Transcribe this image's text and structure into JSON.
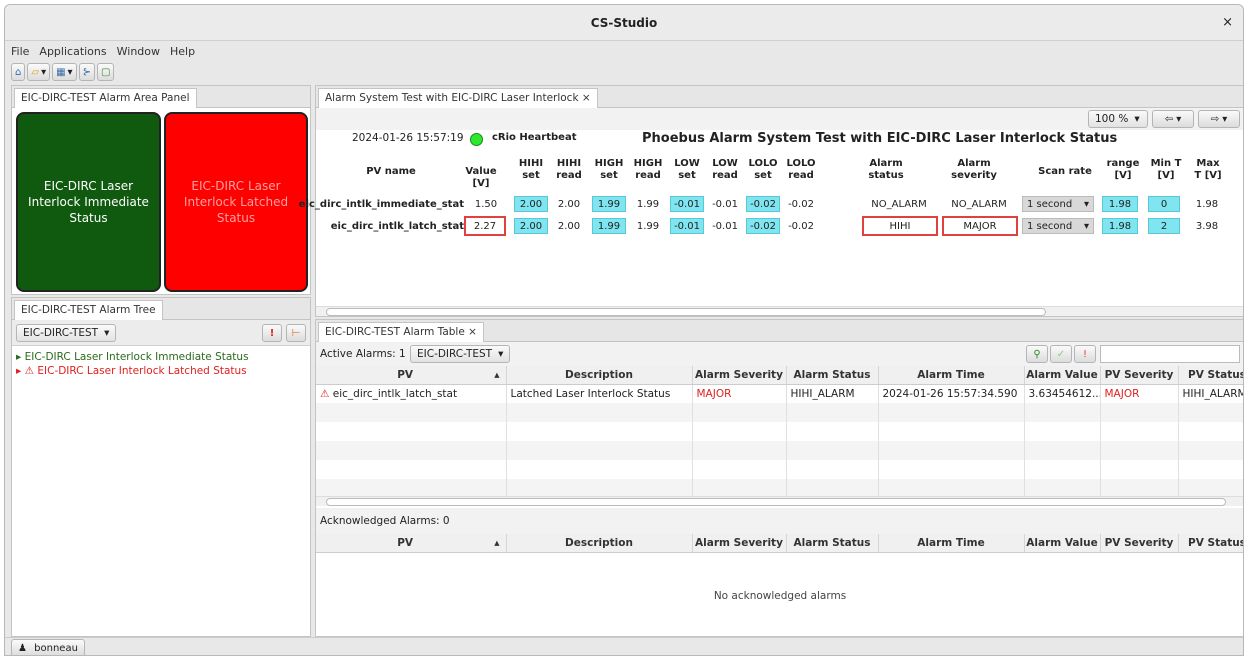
{
  "window": {
    "title": "CS-Studio",
    "close": "×"
  },
  "menu": [
    "File",
    "Applications",
    "Window",
    "Help"
  ],
  "area_panel": {
    "tab": "EIC-DIRC-TEST Alarm Area Panel",
    "tiles": [
      {
        "label": "EIC-DIRC Laser Interlock Immediate Status",
        "color": "#0f5a0f",
        "text_color": "#ffffff"
      },
      {
        "label": "EIC-DIRC Laser Interlock Latched Status",
        "color": "#ff0000",
        "text_color": "#ff9f9f"
      }
    ]
  },
  "alarm_tree": {
    "tab": "EIC-DIRC-TEST Alarm Tree",
    "config": "EIC-DIRC-TEST",
    "items": [
      {
        "label": "EIC-DIRC Laser Interlock Immediate Status",
        "status": "ok"
      },
      {
        "label": "EIC-DIRC Laser Interlock Latched Status",
        "status": "alarm"
      }
    ]
  },
  "display": {
    "tab": "Alarm System Test with EIC-DIRC Laser Interlock",
    "zoom": "100 %",
    "timestamp": "2024-01-26 15:57:19",
    "heartbeat": "cRio Heartbeat",
    "title": "Phoebus Alarm System Test with EIC-DIRC Laser Interlock Status",
    "headers": [
      "PV name",
      "Value [V]",
      "HIHI set",
      "HIHI read",
      "HIGH set",
      "HIGH read",
      "LOW set",
      "LOW read",
      "LOLO set",
      "LOLO read",
      "Alarm status",
      "Alarm severity",
      "Scan rate",
      "range [V]",
      "Min T [V]",
      "Max T [V]"
    ],
    "rows": [
      {
        "pv": "eic_dirc_intlk_immediate_stat",
        "value": "1.50",
        "hihi_set": "2.00",
        "hihi_read": "2.00",
        "high_set": "1.99",
        "high_read": "1.99",
        "low_set": "-0.01",
        "low_read": "-0.01",
        "lolo_set": "-0.02",
        "lolo_read": "-0.02",
        "status": "NO_ALARM",
        "severity": "NO_ALARM",
        "scan": "1 second",
        "range": "1.98",
        "min_t": "0",
        "max_t": "1.98"
      },
      {
        "pv": "eic_dirc_intlk_latch_stat",
        "value": "2.27",
        "hihi_set": "2.00",
        "hihi_read": "2.00",
        "high_set": "1.99",
        "high_read": "1.99",
        "low_set": "-0.01",
        "low_read": "-0.01",
        "lolo_set": "-0.02",
        "lolo_read": "-0.02",
        "status": "HIHI",
        "severity": "MAJOR",
        "scan": "1 second",
        "range": "1.98",
        "min_t": "2",
        "max_t": "3.98"
      }
    ]
  },
  "alarm_table": {
    "tab": "EIC-DIRC-TEST Alarm Table",
    "active_label": "Active Alarms: 1",
    "config": "EIC-DIRC-TEST",
    "columns": [
      "PV",
      "Description",
      "Alarm Severity",
      "Alarm Status",
      "Alarm Time",
      "Alarm Value",
      "PV Severity",
      "PV Status"
    ],
    "active_rows": [
      {
        "pv": "eic_dirc_intlk_latch_stat",
        "description": "Latched Laser Interlock Status",
        "severity": "MAJOR",
        "status": "HIHI_ALARM",
        "time": "2024-01-26 15:57:34.590",
        "value": "3.63454612...",
        "pv_severity": "MAJOR",
        "pv_status": "HIHI_ALARM"
      }
    ],
    "ack_label": "Acknowledged Alarms: 0",
    "ack_empty": "No acknowledged alarms"
  },
  "status_bar": {
    "user": "bonneau"
  },
  "colors": {
    "cyan": "#7fe5f0",
    "major": "#e02020",
    "ok_green": "#2a6a1a"
  }
}
